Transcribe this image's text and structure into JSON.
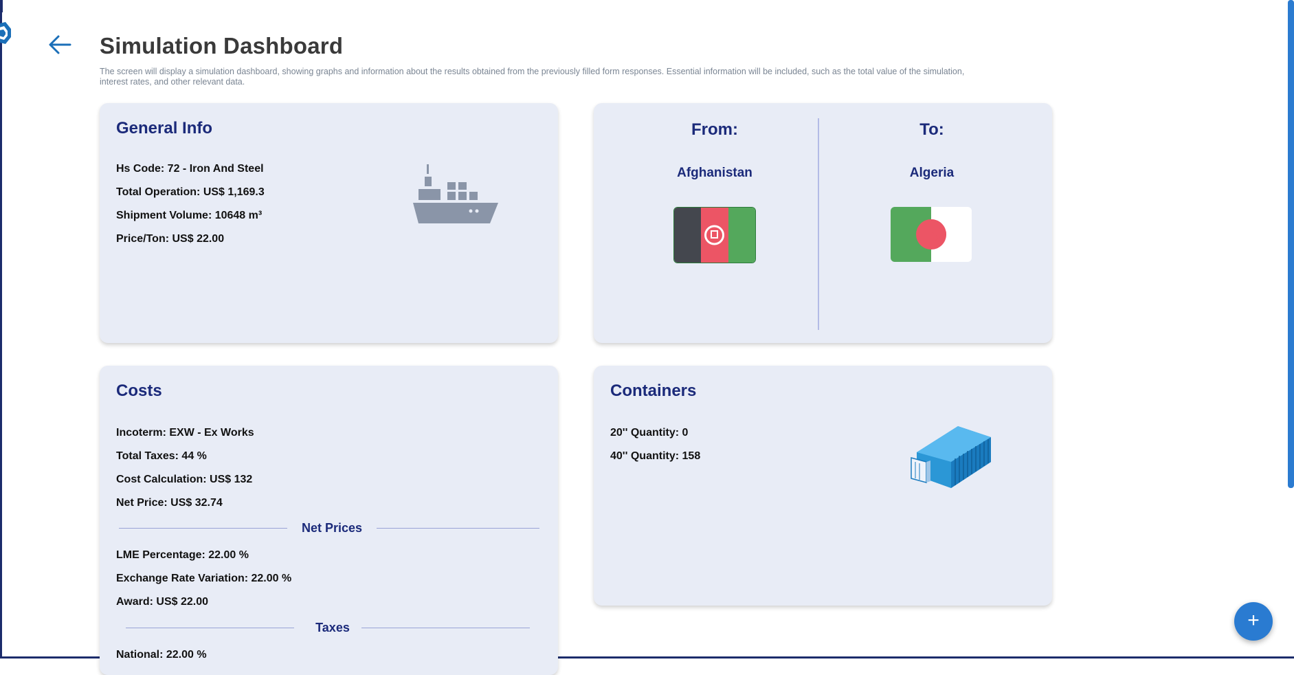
{
  "header": {
    "title": "Simulation Dashboard",
    "description": "The screen will display a simulation dashboard, showing graphs and information about the results obtained from the previously filled form responses. Essential information will be included, such as the total value of the simulation, interest rates, and other relevant data."
  },
  "icons": {
    "back": "arrow-left-icon",
    "logo": "app-logo-icon",
    "ship": "cargo-ship-icon",
    "container": "shipping-container-icon",
    "fab": "plus-icon"
  },
  "general_info": {
    "title": "General Info",
    "hs_code": "Hs Code: 72 - Iron And Steel",
    "total_operation": "Total Operation: US$ 1,169.3",
    "shipment_volume": "Shipment Volume: 10648 m³",
    "price_ton": "Price/Ton: US$ 22.00"
  },
  "route": {
    "from_label": "From:",
    "to_label": "To:",
    "from_country": "Afghanistan",
    "to_country": "Algeria"
  },
  "costs": {
    "title": "Costs",
    "incoterm": "Incoterm: EXW - Ex Works",
    "total_taxes": "Total Taxes: 44 %",
    "cost_calculation": "Cost Calculation: US$ 132",
    "net_price": "Net Price: US$ 32.74",
    "net_prices_heading": "Net Prices",
    "lme_percentage": "LME Percentage: 22.00 %",
    "exchange_rate_variation": "Exchange Rate Variation: 22.00 %",
    "award": "Award: US$ 22.00",
    "taxes_heading": "Taxes",
    "national": "National: 22.00 %"
  },
  "containers": {
    "title": "Containers",
    "qty_20": "20'' Quantity: 0",
    "qty_40": "40'' Quantity: 158"
  },
  "fab": {
    "label": "+"
  },
  "colors": {
    "card_bg": "#e8ecf6",
    "title_blue": "#1b2a7a",
    "accent": "#2a7bd1"
  }
}
